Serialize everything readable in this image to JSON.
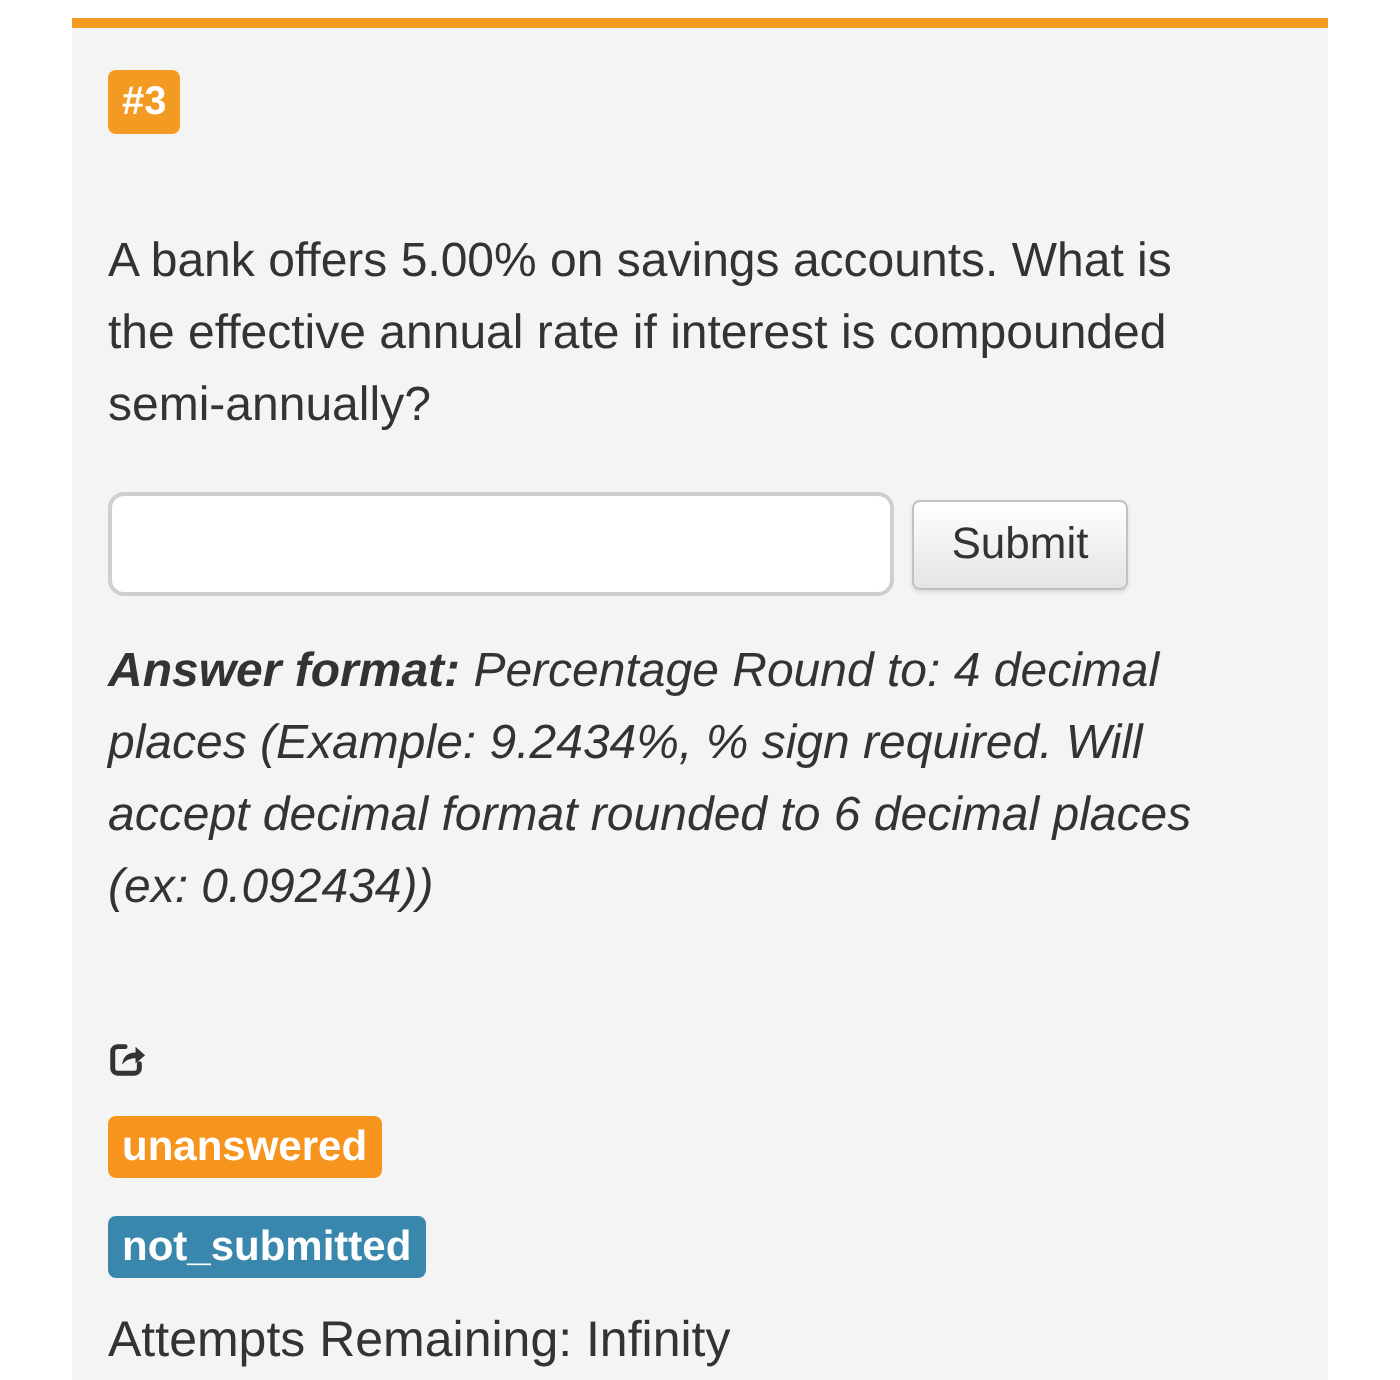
{
  "question_number": "#3",
  "question_text": "A bank offers 5.00% on savings accounts. What is the effective annual rate if interest is compounded semi-annually?",
  "submit_button": "Submit",
  "answer_format": "**Answer format:** Percentage Round to: 4 decimal places (Example: 9.2434%, % sign required. Will accept decimal format rounded to 6 decimal places (ex: 0.092434))",
  "status_labels": [
    {
      "text": "unanswered",
      "color": "#f7941d"
    },
    {
      "text": "not_submitted",
      "color": "#3a87ad"
    }
  ],
  "attempts": "Attempts Remaining: Infinity"
}
